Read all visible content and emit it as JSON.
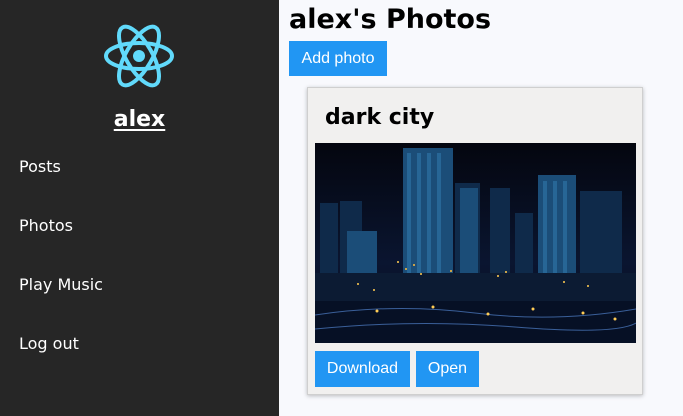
{
  "sidebar": {
    "logo_icon": "react-atom-icon",
    "username": "alex",
    "items": [
      {
        "label": "Posts"
      },
      {
        "label": "Photos"
      },
      {
        "label": "Play Music"
      },
      {
        "label": "Log out"
      }
    ]
  },
  "main": {
    "title": "alex's Photos",
    "add_photo_label": "Add photo",
    "photos": [
      {
        "title": "dark city",
        "download_label": "Download",
        "open_label": "Open"
      }
    ]
  },
  "colors": {
    "sidebar_bg": "#262626",
    "accent": "#2196f3",
    "logo": "#61dafb",
    "page_bg": "#f8f9fd"
  }
}
